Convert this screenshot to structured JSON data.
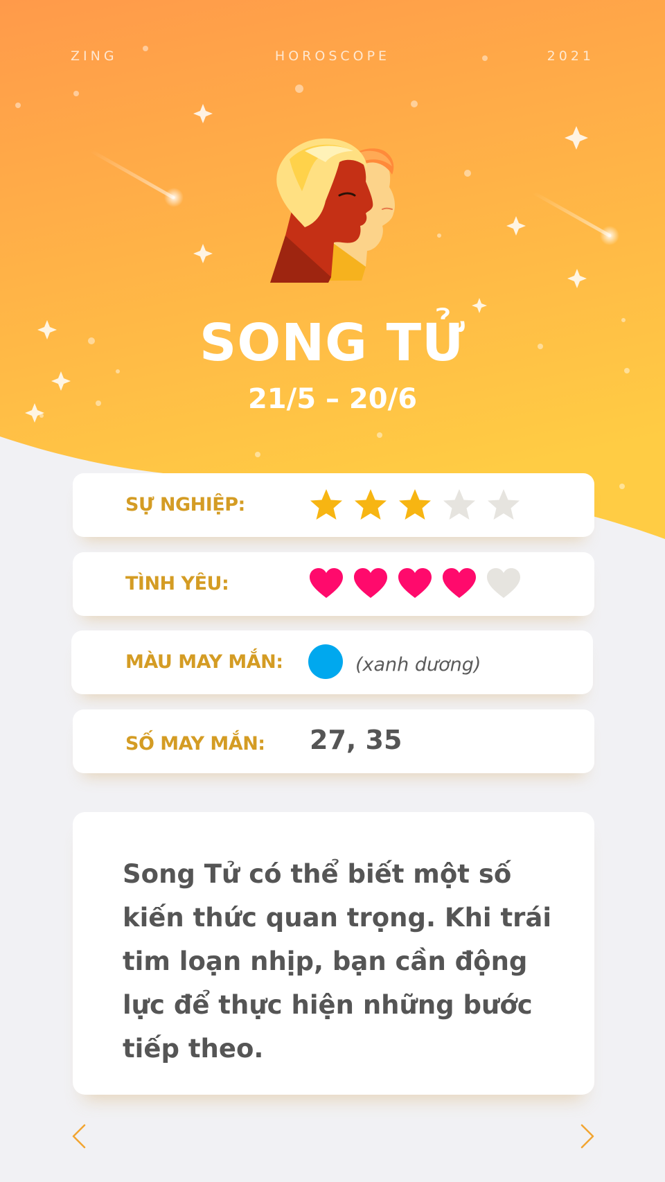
{
  "header": {
    "brand": "ZING",
    "section": "HOROSCOPE",
    "year": "2021"
  },
  "sign": {
    "name": "SONG TỬ",
    "dates": "21/5 – 20/6",
    "icon": "gemini-twins-icon"
  },
  "ratings": {
    "career": {
      "label": "SỰ NGHIỆP:",
      "value": 3,
      "max": 5,
      "icon": "star-icon",
      "color": "#f7b512",
      "empty_color": "#e6e4df"
    },
    "love": {
      "label": "TÌNH YÊU:",
      "value": 4,
      "max": 5,
      "icon": "heart-icon",
      "color": "#ff0a6c",
      "empty_color": "#e6e4df"
    }
  },
  "lucky_color": {
    "label": "MÀU MAY MẮN:",
    "swatch": "#00a8ee",
    "name": "(xanh dương)"
  },
  "lucky_numbers": {
    "label": "SỐ MAY MẮN:",
    "value": "27, 35"
  },
  "description": "Song Tử có thể biết một số kiến thức quan trọng. Khi trái tim loạn nhịp, bạn cần động lực để thực hiện những bước tiếp theo.",
  "nav": {
    "prev_icon": "chevron-left-icon",
    "next_icon": "chevron-right-icon",
    "arrow_color": "#f2a531"
  },
  "theme": {
    "gradient_top": "#ff9a4a",
    "gradient_bottom": "#ffcc44",
    "label_color": "#d49c24",
    "page_bg": "#f1f1f4"
  }
}
